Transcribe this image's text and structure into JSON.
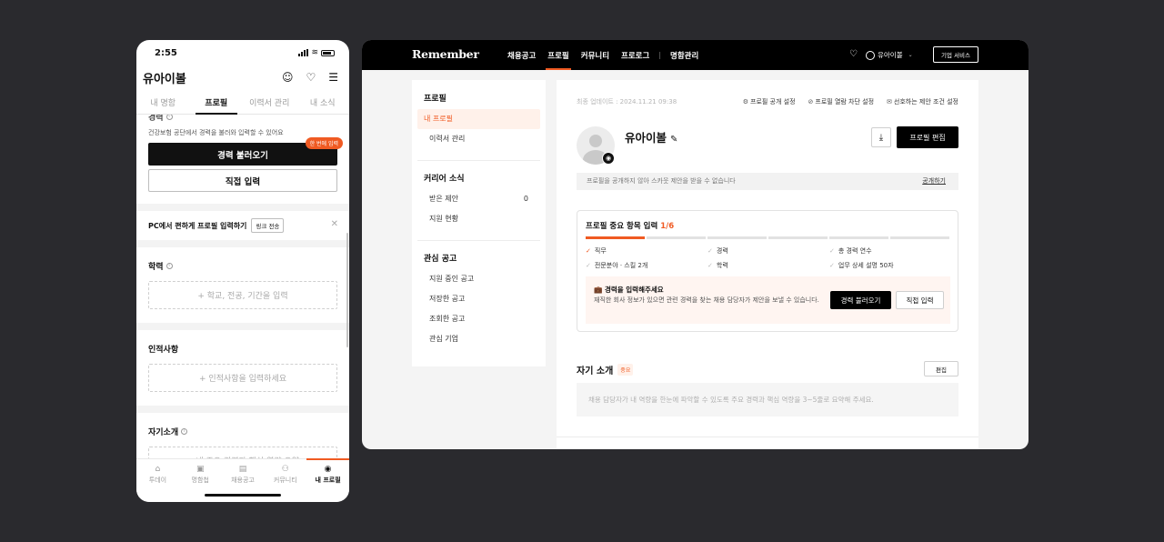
{
  "phone": {
    "status_time": "2:55",
    "title": "유아이볼",
    "header_icons": [
      "person-plus-icon",
      "bell-icon",
      "menu-icon"
    ],
    "tabs": [
      {
        "label": "내 명함",
        "active": false
      },
      {
        "label": "프로필",
        "active": true
      },
      {
        "label": "이력서 관리",
        "active": false
      },
      {
        "label": "내 소식",
        "active": false
      }
    ],
    "career": {
      "title_partial": "경력",
      "desc": "건강보험 공단에서 경력을 불러와 입력할 수 있어요",
      "import_button": "경력 불러오기",
      "badge": "한 번에 입력",
      "manual_button": "직접 입력"
    },
    "pc_banner": {
      "text": "PC에서 편하게 프로필 입력하기",
      "link_button": "링크 전송",
      "close": "✕"
    },
    "education": {
      "title": "학력",
      "placeholder": "+ 학교, 전공, 기간을 입력"
    },
    "personality": {
      "title": "인적사항",
      "placeholder": "+ 인적사항을 입력하세요"
    },
    "intro": {
      "title": "자기소개",
      "placeholder": "+ 내 주요 경력과 핵심 역량 요약"
    },
    "bottom_nav": [
      {
        "label": "투데이",
        "icon": "home-icon",
        "glyph": "⌂",
        "active": false
      },
      {
        "label": "명함첩",
        "icon": "cards-icon",
        "glyph": "▣",
        "active": false
      },
      {
        "label": "채용공고",
        "icon": "briefcase-icon",
        "glyph": "▤",
        "active": false
      },
      {
        "label": "커뮤니티",
        "icon": "community-icon",
        "glyph": "⚇",
        "active": false
      },
      {
        "label": "내 프로필",
        "icon": "profile-icon",
        "glyph": "◉",
        "active": true
      }
    ]
  },
  "desktop": {
    "logo": "Remember",
    "nav": [
      {
        "label": "채용공고",
        "active": false
      },
      {
        "label": "프로필",
        "active": true
      },
      {
        "label": "커뮤니티",
        "active": false
      },
      {
        "label": "프로로그",
        "active": false
      },
      {
        "label": "명함관리",
        "active": false
      }
    ],
    "nav_separator": "|",
    "user_name": "유아이볼",
    "business_button": "기업 서비스",
    "sidebar": {
      "profile_header": "프로필",
      "profile_items": [
        {
          "label": "내 프로필",
          "active": true
        },
        {
          "label": "이력서 관리",
          "active": false
        }
      ],
      "career_header": "커리어 소식",
      "career_items": [
        {
          "label": "받은 제안",
          "count": "0"
        },
        {
          "label": "지원 현황",
          "count": ""
        }
      ],
      "interest_header": "관심 공고",
      "interest_items": [
        {
          "label": "지원 중인 공고"
        },
        {
          "label": "저장한 공고"
        },
        {
          "label": "조회한 공고"
        },
        {
          "label": "관심 기업"
        }
      ]
    },
    "main": {
      "updated": "최종 업데이트 : 2024.11.21 09:38",
      "top_links": [
        {
          "label": "프로필 공개 설정",
          "icon": "gear-icon",
          "glyph": "⚙"
        },
        {
          "label": "프로필 열람 차단 설정",
          "icon": "eye-off-icon",
          "glyph": "⊘"
        },
        {
          "label": "선호하는 제안 조건 설정",
          "icon": "mail-icon",
          "glyph": "✉"
        }
      ],
      "name": "유아이볼",
      "edit_button": "프로필 편집",
      "notice": "프로필을 공개하지 않아 스카웃 제안을 받을 수 없습니다",
      "notice_link": "공개하기",
      "card": {
        "title": "프로필 중요 항목 입력",
        "progress_text": "1/6",
        "progress": {
          "done": 1,
          "total": 6
        },
        "items": [
          {
            "label": "직무",
            "done": true
          },
          {
            "label": "경력",
            "done": false
          },
          {
            "label": "총 경력 연수",
            "done": false
          },
          {
            "label": "전문분야 · 스킬 2개",
            "done": false
          },
          {
            "label": "학력",
            "done": false
          },
          {
            "label": "업무 상세 설명 50자",
            "done": false
          }
        ],
        "tip_title": "경력을 입력해주세요",
        "tip_emoji": "💼",
        "tip_desc": "재직한 회사 정보가 있으면 관련 경력을 찾는 채용 담당자가 제안을 보낼 수 있습니다.",
        "import_button": "경력 불러오기",
        "manual_button": "직접 입력"
      },
      "intro": {
        "title": "자기 소개",
        "badge": "중요",
        "edit_button": "편집",
        "placeholder": "채용 담당자가 내 역량을 한눈에 파악할 수 있도록 주요 경력과 핵심 역량을 3~5줄로 요약해 주세요."
      }
    }
  }
}
